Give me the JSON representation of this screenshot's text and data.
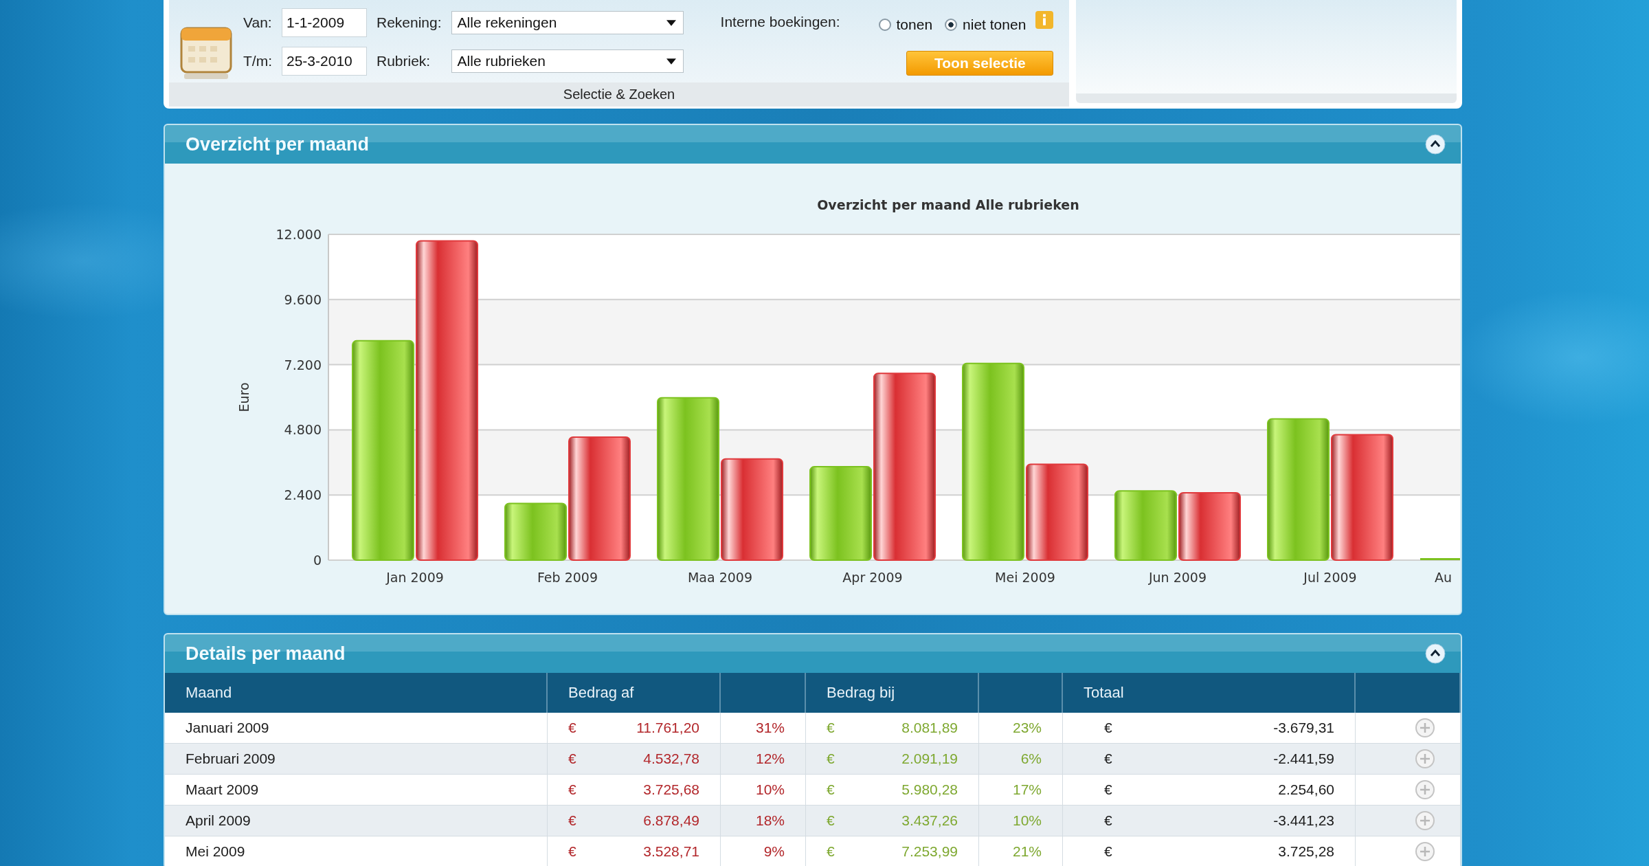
{
  "selection": {
    "van": {
      "label": "Van:",
      "value": "1-1-2009"
    },
    "tm": {
      "label": "T/m:",
      "value": "25-3-2010"
    },
    "rekening": {
      "label": "Rekening:",
      "value": "Alle rekeningen"
    },
    "rubriek": {
      "label": "Rubriek:",
      "value": "Alle rubrieken"
    },
    "interne": {
      "label": "Interne boekingen:",
      "options": [
        {
          "label": "tonen",
          "selected": false
        },
        {
          "label": "niet tonen",
          "selected": true
        }
      ]
    },
    "button": "Toon selectie",
    "footer": "Selectie & Zoeken"
  },
  "overview": {
    "title": "Overzicht per maand",
    "expanded": true,
    "chart_data": {
      "type": "bar",
      "title": "Overzicht per maand Alle rubrieken",
      "ylabel": "Euro",
      "categories": [
        "Jan 2009",
        "Feb 2009",
        "Maa 2009",
        "Apr 2009",
        "Mei 2009",
        "Jun 2009",
        "Jul 2009",
        "Au"
      ],
      "series": [
        {
          "color": "#7cc21f",
          "values": [
            8080,
            2090,
            5980,
            3440,
            7250,
            2550,
            5200,
            0
          ]
        },
        {
          "color": "#e0393c",
          "values": [
            11760,
            4530,
            3730,
            6880,
            3530,
            2480,
            4620,
            null
          ]
        }
      ],
      "ylim": [
        0,
        12000
      ],
      "grid": true,
      "yticks": [
        {
          "value": 0,
          "label": "0"
        },
        {
          "value": 2400,
          "label": "2.400"
        },
        {
          "value": 4800,
          "label": "4.800"
        },
        {
          "value": 7200,
          "label": "7.200"
        },
        {
          "value": 9600,
          "label": "9.600"
        },
        {
          "value": 12000,
          "label": "12.000"
        }
      ]
    }
  },
  "details": {
    "title": "Details per maand",
    "expanded": true,
    "columns": [
      "Maand",
      "Bedrag af",
      "Bedrag bij",
      "Totaal"
    ],
    "rows": [
      {
        "maand": "Januari 2009",
        "af": {
          "currency": "€",
          "amount": "11.761,20",
          "percent": "31%"
        },
        "bij": {
          "currency": "€",
          "amount": "8.081,89",
          "percent": "23%"
        },
        "totaal": {
          "currency": "€",
          "amount": "-3.679,31"
        }
      },
      {
        "maand": "Februari 2009",
        "af": {
          "currency": "€",
          "amount": "4.532,78",
          "percent": "12%"
        },
        "bij": {
          "currency": "€",
          "amount": "2.091,19",
          "percent": "6%"
        },
        "totaal": {
          "currency": "€",
          "amount": "-2.441,59"
        }
      },
      {
        "maand": "Maart 2009",
        "af": {
          "currency": "€",
          "amount": "3.725,68",
          "percent": "10%"
        },
        "bij": {
          "currency": "€",
          "amount": "5.980,28",
          "percent": "17%"
        },
        "totaal": {
          "currency": "€",
          "amount": "2.254,60"
        }
      },
      {
        "maand": "April 2009",
        "af": {
          "currency": "€",
          "amount": "6.878,49",
          "percent": "18%"
        },
        "bij": {
          "currency": "€",
          "amount": "3.437,26",
          "percent": "10%"
        },
        "totaal": {
          "currency": "€",
          "amount": "-3.441,23"
        }
      },
      {
        "maand": "Mei 2009",
        "af": {
          "currency": "€",
          "amount": "3.528,71",
          "percent": "9%"
        },
        "bij": {
          "currency": "€",
          "amount": "7.253,99",
          "percent": "21%"
        },
        "totaal": {
          "currency": "€",
          "amount": "3.725,28"
        }
      }
    ]
  }
}
